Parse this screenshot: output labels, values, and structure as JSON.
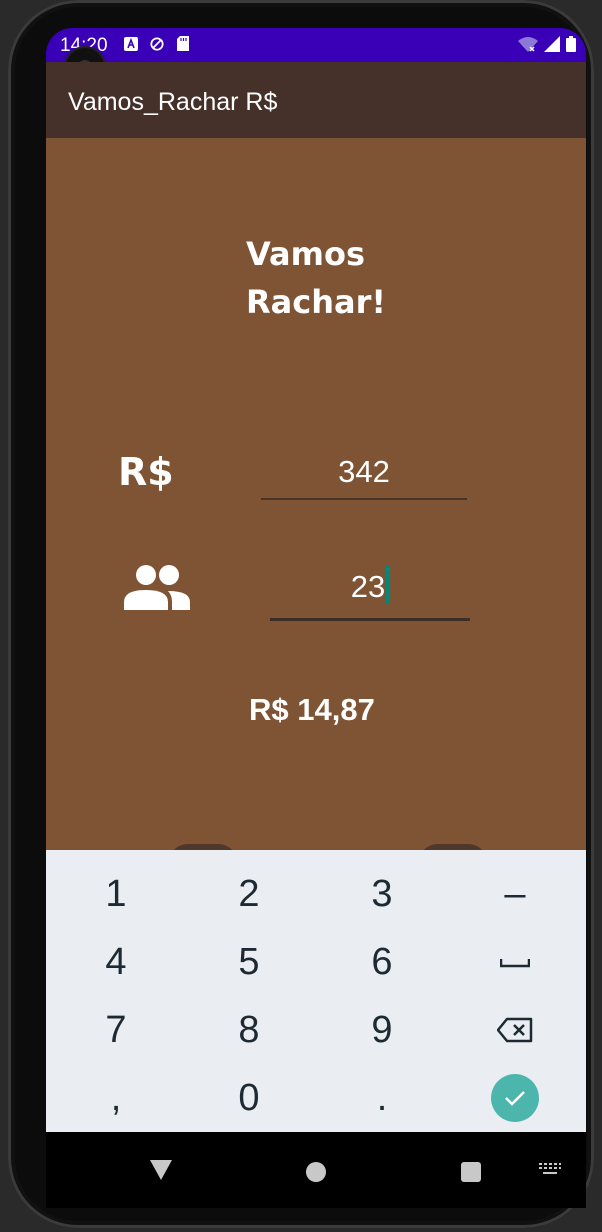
{
  "status_bar": {
    "time": "14:20"
  },
  "app_bar": {
    "title": "Vamos_Rachar R$"
  },
  "main": {
    "heading": "Vamos Rachar!",
    "currency_label": "R$",
    "amount_value": "342",
    "people_value": "23",
    "result": "R$ 14,87"
  },
  "keyboard": {
    "keys": [
      "1",
      "2",
      "3",
      "–",
      "4",
      "5",
      "6",
      "",
      "7",
      "8",
      "9",
      "",
      ",",
      "0",
      ".",
      ""
    ],
    "key_names": [
      "key-1",
      "key-2",
      "key-3",
      "minus-key",
      "key-4",
      "key-5",
      "key-6",
      "space-key",
      "key-7",
      "key-8",
      "key-9",
      "backspace-key",
      "comma-key",
      "key-0",
      "period-key",
      "enter-key"
    ]
  },
  "colors": {
    "status_bar": "#3a00b8",
    "app_bar": "#46302a",
    "background": "#7e5434",
    "keyboard": "#eaeef2",
    "accent": "#4db6ac"
  }
}
